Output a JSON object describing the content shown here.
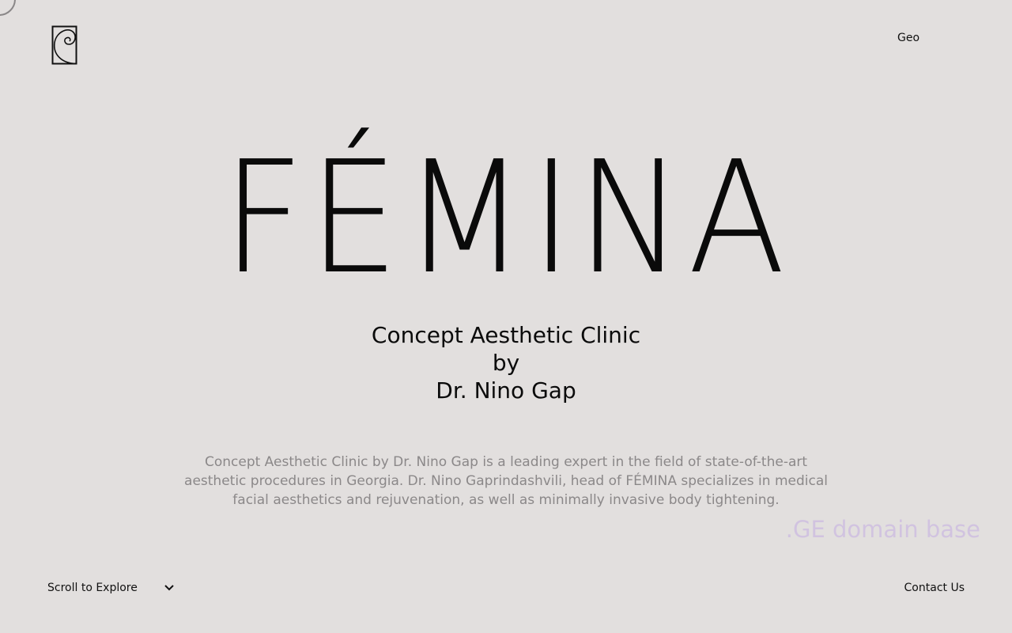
{
  "header": {
    "logo_icon": "golden-spiral-logo-icon",
    "language_label": "Geo"
  },
  "hero": {
    "title": "FÉMINA",
    "subtitle_line1": "Concept Aesthetic Clinic",
    "subtitle_line2": "by",
    "subtitle_line3": "Dr. Nino Gap",
    "description": "Concept Aesthetic Clinic by Dr. Nino Gap is a leading expert in the field of state-of-the-art aesthetic procedures in Georgia. Dr. Nino Gaprindashvili, head of FÉMINA specializes in medical facial aesthetics and rejuvenation, as well as minimally invasive body tightening."
  },
  "overlay": {
    "watermark": ".GE domain base"
  },
  "footer": {
    "scroll_label": "Scroll to Explore",
    "scroll_icon": "chevron-down-icon",
    "contact_label": "Contact Us"
  },
  "colors": {
    "background": "#e2dfde",
    "text": "#0a0a0a",
    "muted": "#8b8889",
    "watermark": "#d1c3e0"
  }
}
